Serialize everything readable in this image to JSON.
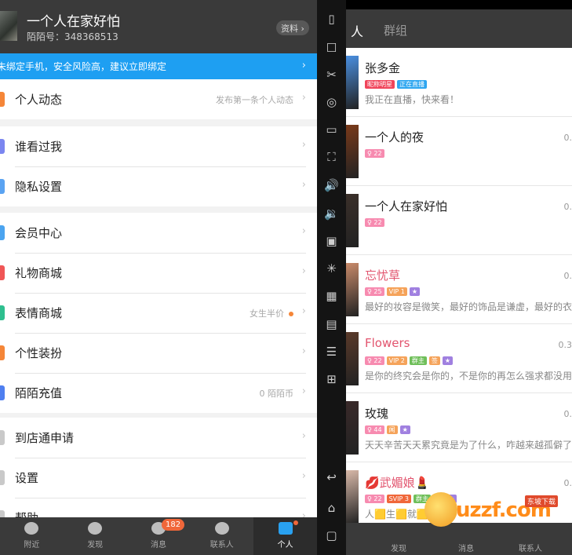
{
  "profile": {
    "name": "一个人在家好怕",
    "id_text": "陌陌号：348368513",
    "profile_button": "资料 ›"
  },
  "banner": {
    "text": "未绑定手机，安全风险高，建议立即绑定",
    "chevron": "›"
  },
  "menu": {
    "groups": [
      [
        {
          "label": "个人动态",
          "right": "发布第一条个人动态",
          "color": "#f58638",
          "dot": false
        }
      ],
      [
        {
          "label": "谁看过我",
          "right": "",
          "color": "#7b86f0",
          "dot": false
        },
        {
          "label": "隐私设置",
          "right": "",
          "color": "#5aa3f2",
          "dot": false
        }
      ],
      [
        {
          "label": "会员中心",
          "right": "",
          "color": "#4ba4f0",
          "dot": false
        },
        {
          "label": "礼物商城",
          "right": "",
          "color": "#f05656",
          "dot": false
        },
        {
          "label": "表情商城",
          "right": "女生半价",
          "color": "#2fbf8f",
          "dot": true
        },
        {
          "label": "个性装扮",
          "right": "",
          "color": "#f58638",
          "dot": false
        },
        {
          "label": "陌陌充值",
          "right": "0 陌陌币",
          "color": "#4f7ff0",
          "dot": false
        }
      ],
      [
        {
          "label": "到店通申请",
          "right": "",
          "color": "#c9c9c9",
          "dot": false
        },
        {
          "label": "设置",
          "right": "",
          "color": "#c9c9c9",
          "dot": false
        },
        {
          "label": "帮助",
          "right": "",
          "color": "#c9c9c9",
          "dot": false
        }
      ]
    ]
  },
  "left_tabs": [
    {
      "label": "附近",
      "badge": "",
      "dot": false,
      "active": false,
      "icon": "location-icon"
    },
    {
      "label": "发现",
      "badge": "",
      "dot": false,
      "active": false,
      "icon": "eye-icon"
    },
    {
      "label": "消息",
      "badge": "182",
      "dot": false,
      "active": false,
      "icon": "chat-icon"
    },
    {
      "label": "联系人",
      "badge": "",
      "dot": false,
      "active": false,
      "icon": "contacts-icon"
    },
    {
      "label": "个人",
      "badge": "",
      "dot": true,
      "active": true,
      "icon": "profile-card-icon"
    }
  ],
  "toolbar_icons": [
    "phone-shake-icon",
    "robot-icon",
    "scissors-icon",
    "location-icon",
    "screen-icon",
    "fullscreen-icon",
    "volume-up-icon",
    "volume-down-icon",
    "apk-install-icon",
    "loading-icon",
    "screenshot-icon",
    "video-icon",
    "layers-icon",
    "add-window-icon",
    "back-icon",
    "home-icon",
    "recent-apps-icon"
  ],
  "tabs_right": {
    "tab1": "人",
    "tab2": "群组"
  },
  "contacts": [
    {
      "name": "张多金",
      "pink": false,
      "distance": "",
      "msg": "我正在直播，快来看！",
      "badges": [
        {
          "t": "昵称明星",
          "c": "#f0445a"
        },
        {
          "t": "正在直播",
          "c": "#2ea6f0"
        }
      ],
      "av": "#4a8fe0"
    },
    {
      "name": "一个人的夜",
      "pink": false,
      "distance": "0.",
      "msg": "",
      "badges": [
        {
          "t": "♀ 22",
          "c": "#f78bb0"
        }
      ],
      "av": "#7a3a1a"
    },
    {
      "name": "一个人在家好怕",
      "pink": false,
      "distance": "0.",
      "msg": "",
      "badges": [
        {
          "t": "♀ 22",
          "c": "#f78bb0"
        }
      ],
      "av": "#3b302a"
    },
    {
      "name": "忘忧草",
      "pink": true,
      "distance": "0.",
      "msg": "最好的妆容是微笑，最好的饰品是谦虚，最好的衣裳",
      "badges": [
        {
          "t": "♀ 25",
          "c": "#f78bb0"
        },
        {
          "t": "VIP 1",
          "c": "#f5a35a"
        },
        {
          "t": "★",
          "c": "#a080e0"
        }
      ],
      "av": "#c88a6a"
    },
    {
      "name": "Flowers",
      "pink": true,
      "distance": "0.3",
      "msg": "是你的终究会是你的，不是你的再怎么强求都没用！",
      "badges": [
        {
          "t": "♀ 22",
          "c": "#f78bb0"
        },
        {
          "t": "VIP 2",
          "c": "#f5a35a"
        },
        {
          "t": "群主",
          "c": "#6fbf5a"
        },
        {
          "t": "签",
          "c": "#f5a35a"
        },
        {
          "t": "★",
          "c": "#a080e0"
        }
      ],
      "av": "#5a3a2a"
    },
    {
      "name": "玫瑰",
      "pink": false,
      "distance": "0.",
      "msg": "天天辛苦天天累究竟是为了什么，咋越来越孤僻了呢",
      "badges": [
        {
          "t": "♀ 44",
          "c": "#f78bb0"
        },
        {
          "t": "闻",
          "c": "#f5a35a"
        },
        {
          "t": "★",
          "c": "#a080e0"
        }
      ],
      "av": "#3a2a2a"
    },
    {
      "name": "💋武媚娘💄",
      "pink": true,
      "distance": "0.",
      "msg": "人🟨生🟨就🟨",
      "badges": [
        {
          "t": "♀ 22",
          "c": "#f78bb0"
        },
        {
          "t": "SVIP 3",
          "c": "#f0673a"
        },
        {
          "t": "群主",
          "c": "#6fbf5a"
        },
        {
          "t": "闻",
          "c": "#f5a35a"
        },
        {
          "t": "★",
          "c": "#a080e0"
        }
      ],
      "av": "#d8b8a8"
    }
  ],
  "right_tabs": {
    "t1": "发现",
    "t2": "消息",
    "t3": "联系人"
  },
  "watermark": {
    "text": "uzzf.com",
    "sub": "东坡下载"
  }
}
